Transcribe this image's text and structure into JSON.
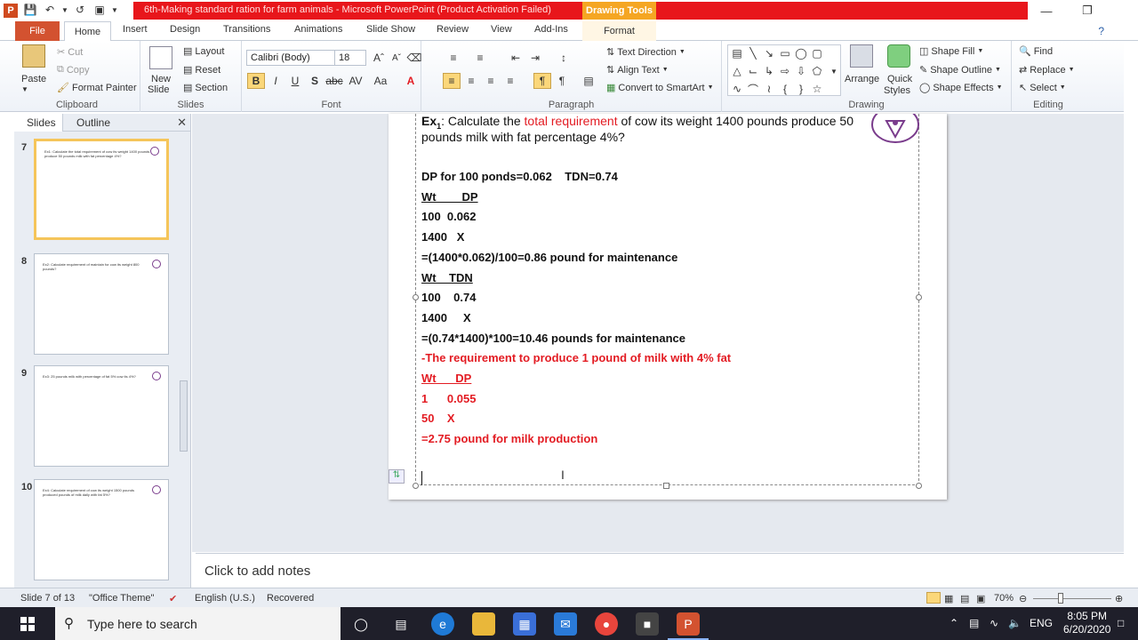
{
  "window": {
    "title": "6th-Making standard ration for farm animals  -  Microsoft PowerPoint (Product Activation Failed)",
    "contextual_tab_group": "Drawing Tools"
  },
  "tabs": [
    "File",
    "Home",
    "Insert",
    "Design",
    "Transitions",
    "Animations",
    "Slide Show",
    "Review",
    "View",
    "Add-Ins",
    "Format"
  ],
  "ribbon": {
    "clipboard": {
      "label": "Clipboard",
      "paste": "Paste",
      "cut": "Cut",
      "copy": "Copy",
      "format_painter": "Format Painter"
    },
    "slides": {
      "label": "Slides",
      "new_slide_line1": "New",
      "new_slide_line2": "Slide",
      "layout": "Layout",
      "reset": "Reset",
      "section": "Section"
    },
    "font": {
      "label": "Font",
      "family": "Calibri (Body)",
      "size": "18"
    },
    "paragraph": {
      "label": "Paragraph",
      "text_direction": "Text Direction",
      "align_text": "Align Text",
      "convert_smartart": "Convert to SmartArt"
    },
    "drawing": {
      "label": "Drawing",
      "arrange": "Arrange",
      "quick_styles_line1": "Quick",
      "quick_styles_line2": "Styles",
      "shape_fill": "Shape Fill",
      "shape_outline": "Shape Outline",
      "shape_effects": "Shape Effects"
    },
    "editing": {
      "label": "Editing",
      "find": "Find",
      "replace": "Replace",
      "select": "Select"
    }
  },
  "pane": {
    "tabs": [
      "Slides",
      "Outline"
    ],
    "thumbnails": [
      {
        "num": "7",
        "text": "Ex1: Calculate the total requirement of cow its weight 1400 pounds produce 50 pounds milk with fat percentage 4%?"
      },
      {
        "num": "8",
        "text": "Ex2: Calculate requirement of maintain for cow its weight 800 pounds?"
      },
      {
        "num": "9",
        "text": "Ex3: 25 pounds milk with percentage of fat 5% cow its 4%?"
      },
      {
        "num": "10",
        "text": "Ex4: Calculate requirement of cow its weight 1500 pounds produced pounds of milk daily with fat 5%?"
      }
    ]
  },
  "slide": {
    "question_prefix": "Ex",
    "question_sub": "1",
    "question_part1": ": Calculate the ",
    "question_red": "total requirement",
    "question_part2": " of cow its weight 1400 pounds produce 50",
    "question_line2": "pounds milk with fat percentage 4%?",
    "lines": [
      {
        "text": "DP for 100 ponds=0.062    TDN=0.74",
        "red": false,
        "u": false
      },
      {
        "text": "Wt        DP",
        "red": false,
        "u": true
      },
      {
        "text": "100  0.062",
        "red": false,
        "u": false
      },
      {
        "text": "1400   X",
        "red": false,
        "u": false
      },
      {
        "text": "=(1400*0.062)/100=0.86 pound for maintenance",
        "red": false,
        "u": false
      },
      {
        "text": "Wt    TDN",
        "red": false,
        "u": true
      },
      {
        "text": "100    0.74",
        "red": false,
        "u": false
      },
      {
        "text": "1400     X",
        "red": false,
        "u": false
      },
      {
        "text": "=(0.74*1400)*100=10.46 pounds for maintenance",
        "red": false,
        "u": false
      },
      {
        "text": "-The requirement to produce 1 pound of milk with 4% fat",
        "red": true,
        "u": false
      },
      {
        "text": "Wt      DP",
        "red": true,
        "u": true
      },
      {
        "text": "1      0.055",
        "red": true,
        "u": false
      },
      {
        "text": "50    X",
        "red": true,
        "u": false
      },
      {
        "text": "=2.75 pound for milk production",
        "red": true,
        "u": false
      }
    ]
  },
  "notes_placeholder": "Click to add notes",
  "status": {
    "slide": "Slide 7 of 13",
    "theme": "\"Office Theme\"",
    "language": "English (U.S.)",
    "recovered": "Recovered",
    "zoom": "70%"
  },
  "taskbar": {
    "search_placeholder": "Type here to search",
    "lang": "ENG",
    "time": "8:05 PM",
    "date": "6/20/2020"
  },
  "colors": {
    "title_red": "#e8161b",
    "drawing_tools": "#f5a623",
    "file_tab": "#d35230",
    "accent_red": "#e31c23"
  }
}
